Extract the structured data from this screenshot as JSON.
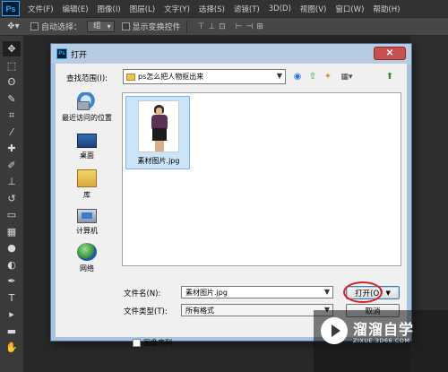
{
  "photoshop": {
    "logo": "Ps",
    "menu": [
      "文件(F)",
      "编辑(E)",
      "图像(I)",
      "图层(L)",
      "文字(Y)",
      "选择(S)",
      "滤镜(T)",
      "3D(D)",
      "视图(V)",
      "窗口(W)",
      "帮助(H)"
    ],
    "options_bar": {
      "tool_icon": "move-icon",
      "auto_select_label": "自动选择：",
      "auto_select_value": "组",
      "show_transform_label": "显示变换控件",
      "align_icons": "⊤⊥⊡ ⊢⊣⊞"
    },
    "tools": [
      {
        "name": "move-tool-icon",
        "glyph": "✥"
      },
      {
        "name": "marquee-tool-icon",
        "glyph": "⬚"
      },
      {
        "name": "lasso-tool-icon",
        "glyph": "ʘ"
      },
      {
        "name": "quick-select-tool-icon",
        "glyph": "✎"
      },
      {
        "name": "crop-tool-icon",
        "glyph": "⌗"
      },
      {
        "name": "eyedropper-tool-icon",
        "glyph": "⁄"
      },
      {
        "name": "healing-tool-icon",
        "glyph": "✚"
      },
      {
        "name": "brush-tool-icon",
        "glyph": "✐"
      },
      {
        "name": "clone-stamp-tool-icon",
        "glyph": "⊥"
      },
      {
        "name": "history-brush-tool-icon",
        "glyph": "↺"
      },
      {
        "name": "eraser-tool-icon",
        "glyph": "▭"
      },
      {
        "name": "gradient-tool-icon",
        "glyph": "▦"
      },
      {
        "name": "blur-tool-icon",
        "glyph": "●"
      },
      {
        "name": "dodge-tool-icon",
        "glyph": "◐"
      },
      {
        "name": "pen-tool-icon",
        "glyph": "✒"
      },
      {
        "name": "type-tool-icon",
        "glyph": "T"
      },
      {
        "name": "path-select-tool-icon",
        "glyph": "▸"
      },
      {
        "name": "shape-tool-icon",
        "glyph": "▬"
      },
      {
        "name": "hand-tool-icon",
        "glyph": "✋"
      }
    ]
  },
  "dialog": {
    "title": "打开",
    "close_glyph": "✕",
    "look_in_label": "查找范围(I):",
    "look_in_value": "ps怎么把人物抠出来",
    "nav_icons": {
      "back": "◉",
      "up": "⇧",
      "new_folder": "✦",
      "views": "▦▾",
      "extra": "⬆"
    },
    "places": [
      "最近访问的位置",
      "桌面",
      "库",
      "计算机",
      "网络"
    ],
    "files": [
      {
        "name": "素材图片.jpg",
        "selected": true
      }
    ],
    "file_name_label": "文件名(N):",
    "file_name_value": "素材图片.jpg",
    "file_type_label": "文件类型(T):",
    "file_type_value": "所有格式",
    "open_button": "打开(O)",
    "cancel_button": "取消",
    "image_sequence_label": "图像序列"
  },
  "watermark": {
    "text": "溜溜自学",
    "sub": "ZIXUE.3D66.COM"
  }
}
